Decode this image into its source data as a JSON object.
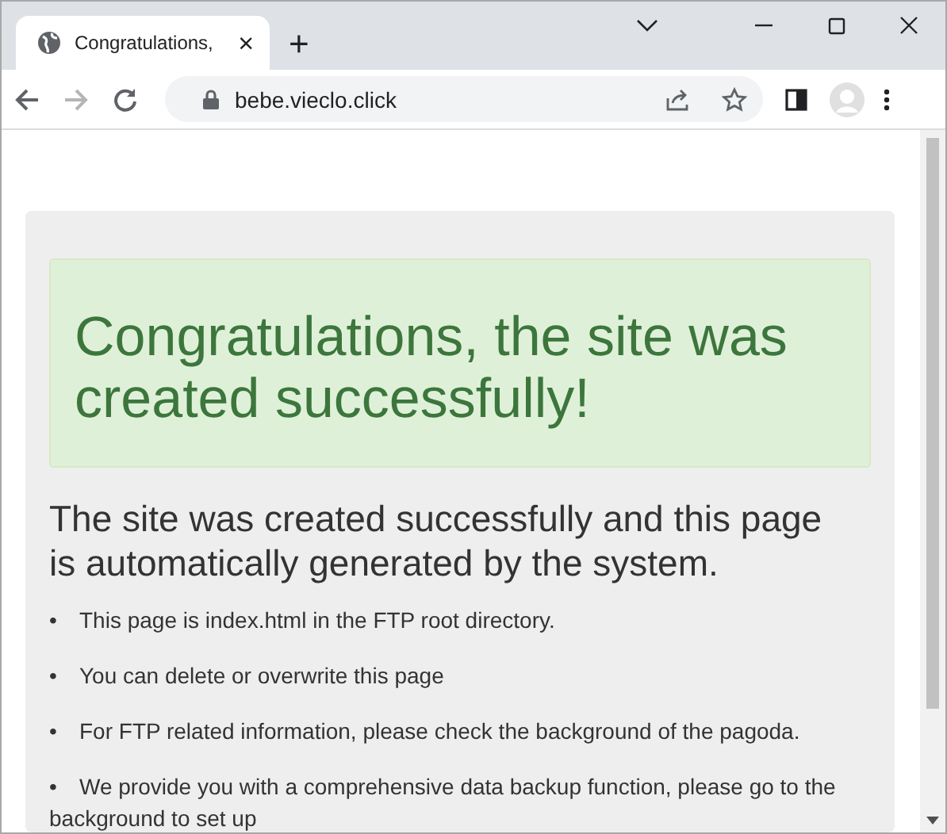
{
  "tab": {
    "title": "Congratulations,",
    "close": "×"
  },
  "new_tab": "+",
  "address_bar": {
    "url": "bebe.vieclo.click",
    "secure": true
  },
  "page": {
    "alert": "Congratulations, the site was created successfully!",
    "heading": "The site was created successfully and this page is automatically generated by the system.",
    "items": [
      {
        "bullet": "•",
        "text": "This page is index.html in the FTP root directory."
      },
      {
        "bullet": "•",
        "text": "You can delete or overwrite this page"
      },
      {
        "bullet": "•",
        "text": "For FTP related information, please check the background of the pagoda."
      },
      {
        "bullet": "•",
        "text": "We provide you with a comprehensive data backup function, please go to the background to set up"
      }
    ]
  }
}
